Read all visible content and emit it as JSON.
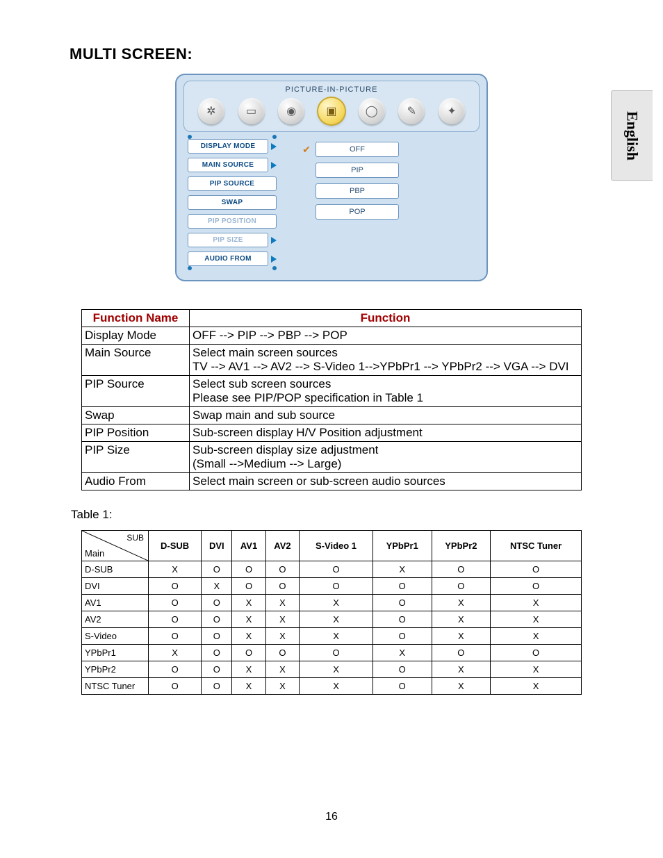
{
  "page": {
    "title": "MULTI SCREEN:",
    "language_tab": "English",
    "page_number": "16",
    "table1_label": "Table 1:"
  },
  "osd": {
    "title": "PICTURE-IN-PICTURE",
    "icons": [
      {
        "name": "picture-mode-icon",
        "glyph": "✲"
      },
      {
        "name": "screen-adjust-icon",
        "glyph": "▭"
      },
      {
        "name": "audio-icon",
        "glyph": "◉"
      },
      {
        "name": "pip-icon",
        "glyph": "▣",
        "active": true
      },
      {
        "name": "geometry-icon",
        "glyph": "◯"
      },
      {
        "name": "tools-icon",
        "glyph": "✎"
      },
      {
        "name": "misc-icon",
        "glyph": "✦"
      }
    ],
    "menu": [
      {
        "label": "DISPLAY MODE",
        "arrow": true,
        "faded": false
      },
      {
        "label": "MAIN SOURCE",
        "arrow": true,
        "faded": false
      },
      {
        "label": "PIP SOURCE",
        "arrow": false,
        "faded": false
      },
      {
        "label": "SWAP",
        "arrow": false,
        "faded": false
      },
      {
        "label": "PIP POSITION",
        "arrow": false,
        "faded": true
      },
      {
        "label": "PIP SIZE",
        "arrow": true,
        "faded": true
      },
      {
        "label": "AUDIO FROM",
        "arrow": true,
        "faded": false
      }
    ],
    "options": [
      {
        "label": "OFF",
        "checked": true
      },
      {
        "label": "PIP",
        "checked": false
      },
      {
        "label": "PBP",
        "checked": false
      },
      {
        "label": "POP",
        "checked": false
      }
    ]
  },
  "fn_table": {
    "headers": {
      "name": "Function Name",
      "desc": "Function"
    },
    "rows": [
      {
        "name": "Display Mode",
        "desc": "OFF --> PIP --> PBP --> POP"
      },
      {
        "name": "Main Source",
        "desc": "Select main screen sources\nTV --> AV1 --> AV2 --> S-Video 1-->YPbPr1 --> YPbPr2 --> VGA --> DVI"
      },
      {
        "name": "PIP Source",
        "desc": "Select sub screen sources\nPlease see PIP/POP specification in Table 1"
      },
      {
        "name": "Swap",
        "desc": "Swap main and sub source"
      },
      {
        "name": "PIP Position",
        "desc": "Sub-screen display H/V Position adjustment"
      },
      {
        "name": "PIP Size",
        "desc": "Sub-screen display size adjustment\n(Small -->Medium --> Large)"
      },
      {
        "name": "Audio From",
        "desc": "Select main screen or sub-screen audio sources"
      }
    ]
  },
  "matrix": {
    "diag": {
      "sub": "SUB",
      "main": "Main"
    },
    "cols": [
      "D-SUB",
      "DVI",
      "AV1",
      "AV2",
      "S-Video 1",
      "YPbPr1",
      "YPbPr2",
      "NTSC Tuner"
    ],
    "rows": [
      {
        "name": "D-SUB",
        "cells": [
          "X",
          "O",
          "O",
          "O",
          "O",
          "X",
          "O",
          "O"
        ]
      },
      {
        "name": "DVI",
        "cells": [
          "O",
          "X",
          "O",
          "O",
          "O",
          "O",
          "O",
          "O"
        ]
      },
      {
        "name": "AV1",
        "cells": [
          "O",
          "O",
          "X",
          "X",
          "X",
          "O",
          "X",
          "X"
        ]
      },
      {
        "name": "AV2",
        "cells": [
          "O",
          "O",
          "X",
          "X",
          "X",
          "O",
          "X",
          "X"
        ]
      },
      {
        "name": "S-Video",
        "cells": [
          "O",
          "O",
          "X",
          "X",
          "X",
          "O",
          "X",
          "X"
        ]
      },
      {
        "name": "YPbPr1",
        "cells": [
          "X",
          "O",
          "O",
          "O",
          "O",
          "X",
          "O",
          "O"
        ]
      },
      {
        "name": "YPbPr2",
        "cells": [
          "O",
          "O",
          "X",
          "X",
          "X",
          "O",
          "X",
          "X"
        ]
      },
      {
        "name": "NTSC Tuner",
        "cells": [
          "O",
          "O",
          "X",
          "X",
          "X",
          "O",
          "X",
          "X"
        ]
      }
    ]
  }
}
